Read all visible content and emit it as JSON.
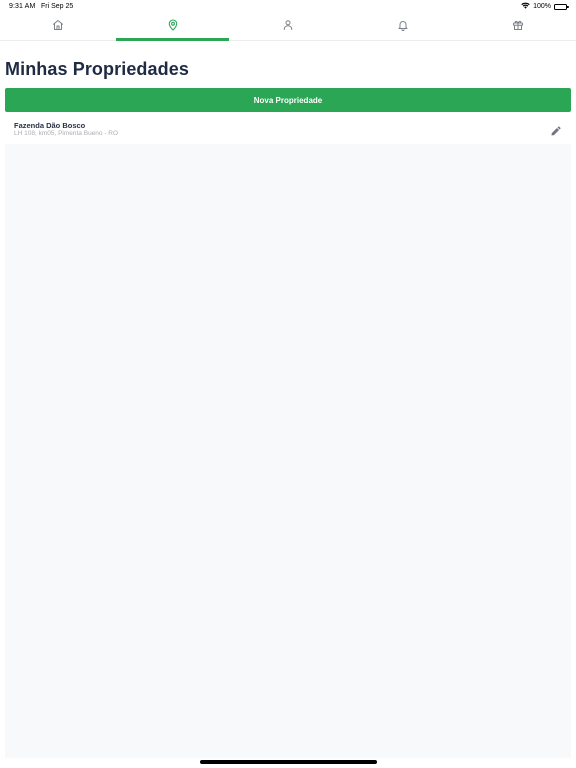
{
  "status_bar": {
    "time": "9:31 AM",
    "date": "Fri Sep 25",
    "battery": "100%",
    "battery_level": 1.0
  },
  "tabs": [
    {
      "icon": "home-icon",
      "active": false
    },
    {
      "icon": "map-pin-icon",
      "active": true
    },
    {
      "icon": "user-icon",
      "active": false
    },
    {
      "icon": "bell-icon",
      "active": false
    },
    {
      "icon": "gift-icon",
      "active": false
    }
  ],
  "colors": {
    "accent": "#2aa655",
    "title": "#1f2a44",
    "icon_inactive": "#7b8088",
    "list_background": "#f8f9fa"
  },
  "main": {
    "title": "Minhas Propriedades",
    "new_button_label": "Nova Propriedade",
    "properties": [
      {
        "name": "Fazenda Dão Bosco",
        "address": "LH 108, km05, Pimenta Bueno - RO",
        "action_icon": "pencil-icon"
      }
    ]
  }
}
